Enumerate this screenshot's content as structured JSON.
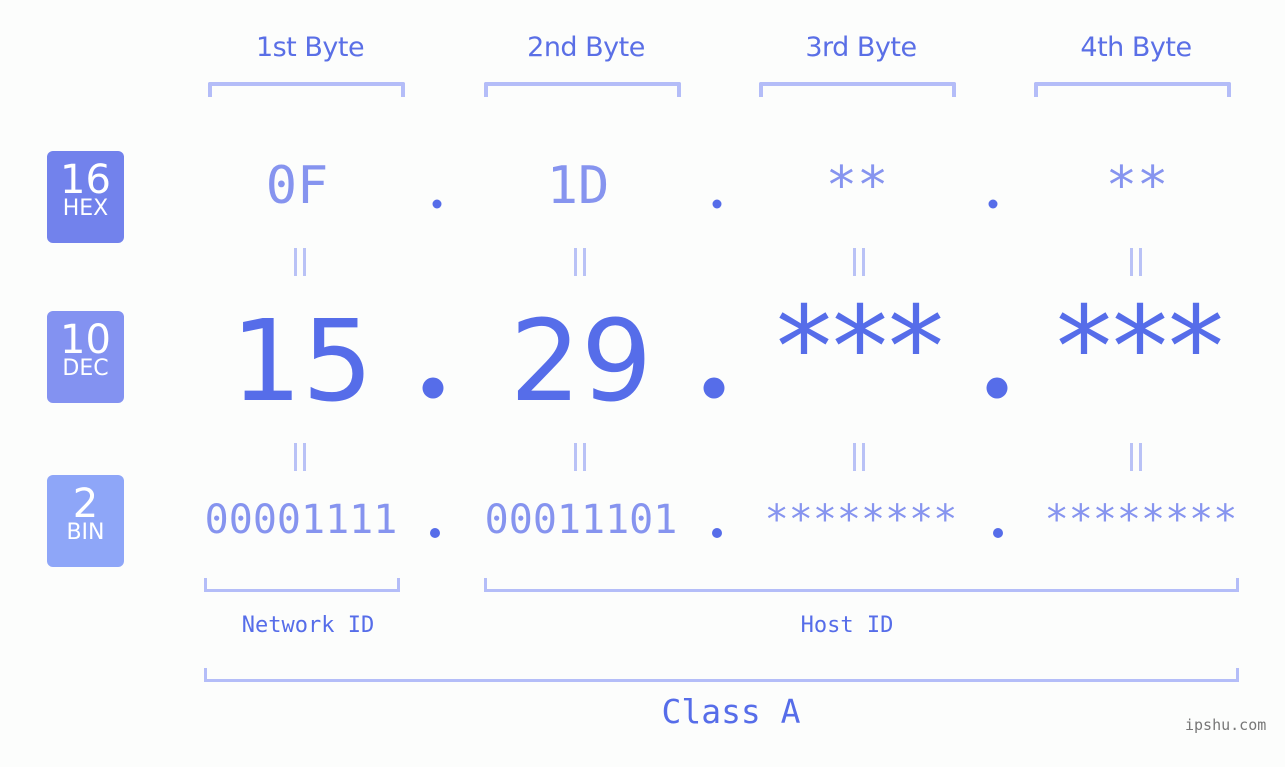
{
  "bytes": {
    "labels": [
      "1st Byte",
      "2nd Byte",
      "3rd Byte",
      "4th Byte"
    ]
  },
  "badges": {
    "hex": {
      "base": "16",
      "label": "HEX",
      "color": "#7282ec"
    },
    "dec": {
      "base": "10",
      "label": "DEC",
      "color": "#8392f1"
    },
    "bin": {
      "base": "2",
      "label": "BIN",
      "color": "#8ea6f8"
    }
  },
  "hex": [
    "0F",
    "1D",
    "**",
    "**"
  ],
  "dec": [
    "15",
    "29",
    "***",
    "***"
  ],
  "bin": [
    "00001111",
    "00011101",
    "********",
    "********"
  ],
  "separator": ".",
  "segments": {
    "network": "Network ID",
    "host": "Host ID",
    "class": "Class A"
  },
  "watermark": "ipshu.com",
  "colors": {
    "accent": "#566de9",
    "light_accent": "#8694ef",
    "bracket": "#b4bdf8",
    "background": "#fcfdfc"
  }
}
